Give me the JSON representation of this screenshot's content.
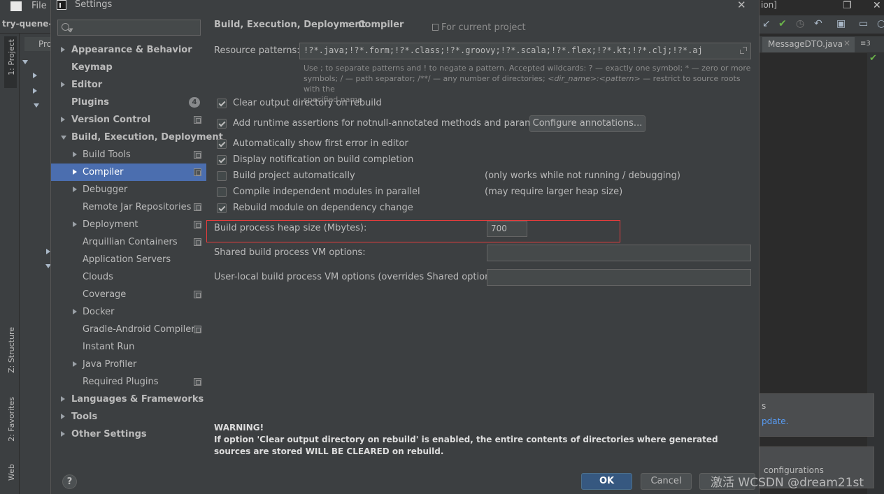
{
  "ide": {
    "menu_file": "File",
    "project_name": "try-quene-c",
    "project_tab": "Pro",
    "left_tabs": {
      "project": "1: Project",
      "structure": "Z: Structure",
      "favorites": "2: Favorites",
      "web": "Web"
    },
    "right_title": "ion]",
    "editor_tab": "MessageDTO.java",
    "tab_count": "≡3",
    "notif1": "s",
    "notif1_link": "pdate.",
    "notif2": "configurations"
  },
  "dialog": {
    "title": "Settings",
    "search_placeholder": "",
    "breadcrumb": {
      "part1": "Build, Execution, Deployment",
      "separator": "›",
      "part2": "Compiler"
    },
    "for_current_project": "For current project",
    "tree": [
      {
        "label": "Appearance & Behavior"
      },
      {
        "label": "Keymap"
      },
      {
        "label": "Editor"
      },
      {
        "label": "Plugins",
        "badge": "4"
      },
      {
        "label": "Version Control"
      },
      {
        "label": "Build, Execution, Deployment"
      },
      {
        "label": "Build Tools"
      },
      {
        "label": "Compiler"
      },
      {
        "label": "Debugger"
      },
      {
        "label": "Remote Jar Repositories"
      },
      {
        "label": "Deployment"
      },
      {
        "label": "Arquillian Containers"
      },
      {
        "label": "Application Servers"
      },
      {
        "label": "Clouds"
      },
      {
        "label": "Coverage"
      },
      {
        "label": "Docker"
      },
      {
        "label": "Gradle-Android Compiler"
      },
      {
        "label": "Instant Run"
      },
      {
        "label": "Java Profiler"
      },
      {
        "label": "Required Plugins"
      },
      {
        "label": "Languages & Frameworks"
      },
      {
        "label": "Tools"
      },
      {
        "label": "Other Settings"
      }
    ],
    "resource_patterns": {
      "label": "Resource patterns:",
      "value": "!?*.java;!?*.form;!?*.class;!?*.groovy;!?*.scala;!?*.flex;!?*.kt;!?*.clj;!?*.aj",
      "hint_line1": "Use ; to separate patterns and ! to negate a pattern. Accepted wildcards: ? — exactly one symbol; * — zero or more",
      "hint_line2_a": "symbols; / — path separator; /**/ — any number of directories; ",
      "hint_line2_b": "<dir_name>:<pattern>",
      "hint_line2_c": " — restrict to source roots with the",
      "hint_line3": "specified name"
    },
    "checkboxes": [
      {
        "label": "Clear output directory on rebuild",
        "checked": true
      },
      {
        "label": "Add runtime assertions for notnull-annotated methods and parameters",
        "checked": true
      },
      {
        "label": "Automatically show first error in editor",
        "checked": true
      },
      {
        "label": "Display notification on build completion",
        "checked": true
      },
      {
        "label": "Build project automatically",
        "checked": false,
        "note": "(only works while not running / debugging)"
      },
      {
        "label": "Compile independent modules in parallel",
        "checked": false,
        "note": "(may require larger heap size)"
      },
      {
        "label": "Rebuild module on dependency change",
        "checked": true
      }
    ],
    "configure_annotations": "Configure annotations...",
    "heap_size": {
      "label": "Build process heap size (Mbytes):",
      "value": "700"
    },
    "shared_vm": {
      "label": "Shared build process VM options:",
      "value": ""
    },
    "user_local_vm": {
      "label": "User-local build process VM options (overrides Shared options):",
      "value": ""
    },
    "warning": {
      "title": "WARNING!",
      "text": "If option 'Clear output directory on rebuild' is enabled, the entire contents of directories where generated sources are stored WILL BE CLEARED on rebuild."
    },
    "buttons": {
      "ok": "OK",
      "cancel": "Cancel",
      "help": "?"
    }
  },
  "watermark": "激活 WCSDN @dream21st",
  "colors": {
    "selection": "#4b6eaf",
    "primary_button": "#365880",
    "highlight_box": "#e53c3c",
    "dialog_bg": "#3c3f41"
  }
}
